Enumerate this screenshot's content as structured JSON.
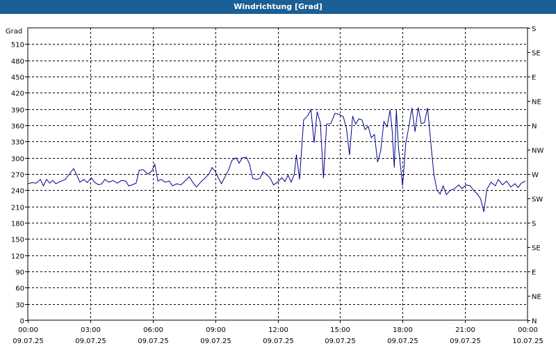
{
  "window": {
    "title": "Windrichtung [Grad]"
  },
  "chart_data": {
    "type": "line",
    "title": "Windrichtung [Grad]",
    "ylabel": "Grad",
    "xlabel": "",
    "ylim": [
      0,
      540
    ],
    "yticks": [
      0,
      30,
      60,
      90,
      120,
      150,
      180,
      210,
      240,
      270,
      300,
      330,
      360,
      390,
      420,
      450,
      480,
      510
    ],
    "y2ticks": [
      {
        "value": 0,
        "label": "N"
      },
      {
        "value": 45,
        "label": "NE"
      },
      {
        "value": 90,
        "label": "E"
      },
      {
        "value": 135,
        "label": "SE"
      },
      {
        "value": 180,
        "label": "S"
      },
      {
        "value": 225,
        "label": "SW"
      },
      {
        "value": 270,
        "label": "W"
      },
      {
        "value": 315,
        "label": "NW"
      },
      {
        "value": 360,
        "label": "N"
      },
      {
        "value": 405,
        "label": "NE"
      },
      {
        "value": 450,
        "label": "E"
      },
      {
        "value": 495,
        "label": "SE"
      },
      {
        "value": 540,
        "label": "S"
      }
    ],
    "xticks": [
      {
        "time": "00:00",
        "date": "09.07.25"
      },
      {
        "time": "03:00",
        "date": "09.07.25"
      },
      {
        "time": "06:00",
        "date": "09.07.25"
      },
      {
        "time": "09:00",
        "date": "09.07.25"
      },
      {
        "time": "12:00",
        "date": "09.07.25"
      },
      {
        "time": "15:00",
        "date": "09.07.25"
      },
      {
        "time": "18:00",
        "date": "09.07.25"
      },
      {
        "time": "21:00",
        "date": "09.07.25"
      },
      {
        "time": "00:00",
        "date": "10.07.25"
      }
    ],
    "xlim_hours": [
      0,
      24
    ],
    "grid": true,
    "line_color": "#00008b",
    "series": [
      {
        "values": [
          [
            0.0,
            252
          ],
          [
            0.2,
            254
          ],
          [
            0.4,
            253
          ],
          [
            0.6,
            260
          ],
          [
            0.75,
            248
          ],
          [
            0.9,
            260
          ],
          [
            1.05,
            253
          ],
          [
            1.2,
            258
          ],
          [
            1.35,
            252
          ],
          [
            1.55,
            256
          ],
          [
            1.8,
            260
          ],
          [
            2.0,
            270
          ],
          [
            2.2,
            280
          ],
          [
            2.35,
            268
          ],
          [
            2.5,
            255
          ],
          [
            2.7,
            260
          ],
          [
            2.85,
            254
          ],
          [
            3.05,
            263
          ],
          [
            3.2,
            255
          ],
          [
            3.4,
            250
          ],
          [
            3.55,
            252
          ],
          [
            3.7,
            260
          ],
          [
            3.9,
            255
          ],
          [
            4.1,
            258
          ],
          [
            4.3,
            253
          ],
          [
            4.5,
            258
          ],
          [
            4.7,
            257
          ],
          [
            4.85,
            248
          ],
          [
            5.0,
            250
          ],
          [
            5.2,
            253
          ],
          [
            5.35,
            277
          ],
          [
            5.55,
            278
          ],
          [
            5.75,
            270
          ],
          [
            5.95,
            275
          ],
          [
            6.1,
            288
          ],
          [
            6.25,
            257
          ],
          [
            6.4,
            260
          ],
          [
            6.6,
            255
          ],
          [
            6.8,
            257
          ],
          [
            6.95,
            248
          ],
          [
            7.15,
            252
          ],
          [
            7.35,
            250
          ],
          [
            7.55,
            257
          ],
          [
            7.75,
            265
          ],
          [
            7.95,
            253
          ],
          [
            8.1,
            246
          ],
          [
            8.3,
            255
          ],
          [
            8.5,
            262
          ],
          [
            8.7,
            270
          ],
          [
            8.85,
            282
          ],
          [
            9.0,
            275
          ],
          [
            9.15,
            263
          ],
          [
            9.3,
            252
          ],
          [
            9.45,
            263
          ],
          [
            9.65,
            278
          ],
          [
            9.8,
            295
          ],
          [
            10.0,
            300
          ],
          [
            10.15,
            290
          ],
          [
            10.3,
            300
          ],
          [
            10.5,
            301
          ],
          [
            10.65,
            288
          ],
          [
            10.8,
            262
          ],
          [
            11.0,
            260
          ],
          [
            11.15,
            262
          ],
          [
            11.3,
            274
          ],
          [
            11.5,
            268
          ],
          [
            11.65,
            262
          ],
          [
            11.8,
            250
          ],
          [
            12.0,
            255
          ],
          [
            12.2,
            263
          ],
          [
            12.35,
            256
          ],
          [
            12.5,
            268
          ],
          [
            12.65,
            255
          ],
          [
            12.8,
            270
          ],
          [
            12.9,
            306
          ],
          [
            13.05,
            260
          ],
          [
            13.25,
            370
          ],
          [
            13.45,
            378
          ],
          [
            13.6,
            389
          ],
          [
            13.75,
            328
          ],
          [
            13.9,
            385
          ],
          [
            14.05,
            365
          ],
          [
            14.2,
            262
          ],
          [
            14.35,
            362
          ],
          [
            14.55,
            363
          ],
          [
            14.75,
            382
          ],
          [
            14.95,
            380
          ],
          [
            15.15,
            376
          ],
          [
            15.3,
            355
          ],
          [
            15.45,
            305
          ],
          [
            15.6,
            377
          ],
          [
            15.75,
            362
          ],
          [
            15.9,
            372
          ],
          [
            16.05,
            370
          ],
          [
            16.2,
            352
          ],
          [
            16.35,
            358
          ],
          [
            16.5,
            337
          ],
          [
            16.65,
            343
          ],
          [
            16.8,
            292
          ],
          [
            16.95,
            313
          ],
          [
            17.1,
            367
          ],
          [
            17.25,
            357
          ],
          [
            17.4,
            388
          ],
          [
            17.5,
            350
          ],
          [
            17.6,
            282
          ],
          [
            17.7,
            388
          ],
          [
            17.8,
            320
          ],
          [
            18.0,
            248
          ],
          [
            18.15,
            325
          ],
          [
            18.3,
            357
          ],
          [
            18.45,
            392
          ],
          [
            18.6,
            348
          ],
          [
            18.75,
            393
          ],
          [
            18.9,
            363
          ],
          [
            19.05,
            365
          ],
          [
            19.2,
            392
          ],
          [
            19.35,
            330
          ],
          [
            19.5,
            270
          ],
          [
            19.65,
            240
          ],
          [
            19.8,
            233
          ],
          [
            19.95,
            248
          ],
          [
            20.1,
            232
          ],
          [
            20.3,
            240
          ],
          [
            20.5,
            243
          ],
          [
            20.7,
            250
          ],
          [
            20.85,
            243
          ],
          [
            21.05,
            250
          ],
          [
            21.25,
            248
          ],
          [
            21.45,
            238
          ],
          [
            21.6,
            233
          ],
          [
            21.75,
            224
          ],
          [
            21.9,
            200
          ],
          [
            22.05,
            242
          ],
          [
            22.25,
            255
          ],
          [
            22.45,
            248
          ],
          [
            22.6,
            260
          ],
          [
            22.8,
            250
          ],
          [
            23.0,
            257
          ],
          [
            23.2,
            246
          ],
          [
            23.4,
            252
          ],
          [
            23.55,
            245
          ],
          [
            23.7,
            253
          ],
          [
            23.9,
            257
          ]
        ]
      }
    ]
  }
}
